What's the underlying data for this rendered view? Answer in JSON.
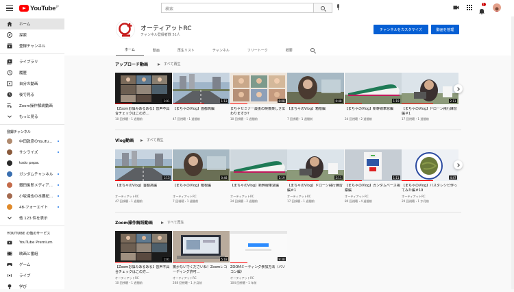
{
  "topbar": {
    "logo_text": "YouTube",
    "logo_region": "JP",
    "search_placeholder": "検索",
    "notification_count": "1"
  },
  "sidebar": {
    "main": [
      {
        "label": "ホーム",
        "icon": "home-icon"
      },
      {
        "label": "探索",
        "icon": "compass-icon"
      },
      {
        "label": "登録チャンネル",
        "icon": "subscriptions-icon"
      }
    ],
    "library": [
      {
        "label": "ライブラリ",
        "icon": "library-icon"
      },
      {
        "label": "履歴",
        "icon": "history-icon"
      },
      {
        "label": "自分の動画",
        "icon": "my-videos-icon"
      },
      {
        "label": "後で見る",
        "icon": "watch-later-icon"
      },
      {
        "label": "Zoom操作解説動画",
        "icon": "playlist-icon"
      },
      {
        "label": "もっと見る",
        "icon": "chevron-down-icon"
      }
    ],
    "subs_heading": "登録チャンネル",
    "subs": [
      {
        "label": "中田敦彦のYouTu...",
        "color": "#b08a6e"
      },
      {
        "label": "サシライズ",
        "color": "#8a5a3c"
      },
      {
        "label": "todo papa.",
        "color": "#2a2a2a"
      },
      {
        "label": "ガンダムチャンネル",
        "color": "#3a6fb0"
      },
      {
        "label": "鐵田俊郎メディア...",
        "color": "#c46b4a"
      },
      {
        "label": "小坂達也の本要紀...",
        "color": "#a46a4f"
      },
      {
        "label": "48-フォーエイト",
        "color": "#e08a2a"
      },
      {
        "label": "他 123 件を表示",
        "color": ""
      }
    ],
    "services_heading": "YOUTUBE の他のサービス",
    "services": [
      {
        "label": "YouTube Premium",
        "icon": "youtube-premium-icon"
      },
      {
        "label": "映画と番組",
        "icon": "movies-icon"
      },
      {
        "label": "ゲーム",
        "icon": "gaming-icon"
      },
      {
        "label": "ライブ",
        "icon": "live-icon"
      },
      {
        "label": "学び",
        "icon": "learning-icon"
      }
    ]
  },
  "channel": {
    "name": "オーティアットRC",
    "subscribers": "チャンネル登録者数 51人",
    "customize_button": "チャンネルをカスタマイズ",
    "manage_button": "動画を管理",
    "tabs": [
      "ホーム",
      "動画",
      "再生リスト",
      "チャンネル",
      "フリートーク",
      "概要"
    ]
  },
  "shelves": [
    {
      "title": "アップロード動画",
      "play_all": "すべて再生",
      "videos": [
        {
          "title": "【Zoomお悩みあるある】音声不具合チェックはこの方...",
          "channel": "",
          "meta": "10 回視聴・1 週間前",
          "duration": "1:01",
          "thumb": "zoom"
        },
        {
          "title": "【まちゃのVlog】首都高編",
          "channel": "",
          "meta": "47 回視聴・1 週間前",
          "duration": "1:13",
          "thumb": "road"
        },
        {
          "title": "まちゃセミナー最後の映像楽しさ伝わりますか？",
          "channel": "",
          "meta": "10 回視聴・1 週間前",
          "duration": "0:08",
          "thumb": "group"
        },
        {
          "title": "【まちゃのVlog】箱根編",
          "channel": "",
          "meta": "7 回視聴・1 週間前",
          "duration": "0:48",
          "thumb": "car"
        },
        {
          "title": "【まちゃのVlog】新幹線車窓編",
          "channel": "",
          "meta": "24 回視聴・2 週間前",
          "duration": "1:19",
          "thumb": "train"
        },
        {
          "title": "【まちゃのVlog】ドローン飛行練習編＃1",
          "channel": "",
          "meta": "17 回視聴・1 週間前",
          "duration": "2:11",
          "thumb": "drone"
        }
      ]
    },
    {
      "title": "Vlog動画",
      "play_all": "すべて再生",
      "videos": [
        {
          "title": "【まちゃのVlog】首都高編",
          "channel": "オーティアットRC",
          "meta": "47 回視聴・1 週間前",
          "duration": "1:13",
          "thumb": "road"
        },
        {
          "title": "【まちゃのVlog】箱根編",
          "channel": "オーティアットRC",
          "meta": "7 回視聴・1 週間前",
          "duration": "0:48",
          "thumb": "car"
        },
        {
          "title": "【まちゃのVlog】新幹線車窓編",
          "channel": "オーティアットRC",
          "meta": "24 回視聴・2 週間前",
          "duration": "1:19",
          "thumb": "train"
        },
        {
          "title": "【まちゃのVlog】ドローン飛行練習編＃1",
          "channel": "オーティアットRC",
          "meta": "17 回視聴・1 週間前",
          "duration": "2:11",
          "thumb": "drone"
        },
        {
          "title": "【まちゃのVlog】ガンダムベース視察編",
          "channel": "オーティアットRC",
          "meta": "80 回視聴・4 週間前",
          "duration": "1:11",
          "thumb": "gundam"
        },
        {
          "title": "【まちゃのVlog】パスタレシピ作ってみた編＃19",
          "channel": "オーティアットRC",
          "meta": "20 回視聴・1 か月前",
          "duration": "4:47",
          "thumb": "pasta"
        }
      ]
    },
    {
      "title": "Zoom操作解説動画",
      "play_all": "すべて再生",
      "videos": [
        {
          "title": "【Zoomお悩みあるある】音声不具合チェックはこの方...",
          "channel": "オーティアットRC",
          "meta": "10 回視聴・1 週間前",
          "duration": "1:01",
          "thumb": "zoom"
        },
        {
          "title": "驚かないでくださいね！Zoomレコーディング許可...",
          "channel": "オーティアットRC",
          "meta": "268 回視聴・1 か月前",
          "duration": "5:18",
          "thumb": "laptop"
        },
        {
          "title": "ZOOMミーティング参加方法（パソコン編）",
          "channel": "オーティアットRC",
          "meta": "104 回視聴・1 年前",
          "duration": "9:38",
          "thumb": "screen"
        }
      ]
    }
  ],
  "colors": {
    "accent_blue": "#065fd4",
    "youtube_red": "#ff0000",
    "progress_red": "#ff0000"
  }
}
